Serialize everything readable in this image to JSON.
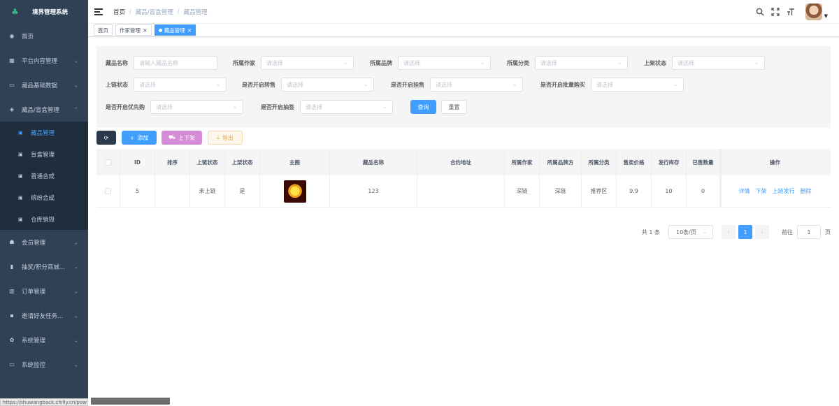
{
  "app": {
    "logo_text": "境界管理系统"
  },
  "sidebar": {
    "items": [
      {
        "label": "首页",
        "icon": "dashboard-icon"
      },
      {
        "label": "平台内容管理",
        "icon": "calendar-icon"
      },
      {
        "label": "藏品基础数据",
        "icon": "monitor-icon"
      },
      {
        "label": "藏品/盲盒管理",
        "icon": "layers-icon"
      },
      {
        "label": "会员管理",
        "icon": "peoples-icon"
      },
      {
        "label": "抽奖/积分商城...",
        "icon": "book-icon"
      },
      {
        "label": "订单管理",
        "icon": "chart-icon"
      },
      {
        "label": "邀请好友任务...",
        "icon": "list-icon"
      },
      {
        "label": "系统管理",
        "icon": "gear-icon"
      },
      {
        "label": "系统监控",
        "icon": "monitor-icon"
      }
    ],
    "submenu": [
      {
        "label": "藏品管理"
      },
      {
        "label": "盲盒管理"
      },
      {
        "label": "普通合成"
      },
      {
        "label": "缤纷合成"
      },
      {
        "label": "仓库销毁"
      }
    ]
  },
  "header": {
    "breadcrumb": [
      "首页",
      "藏品/盲盒管理",
      "藏品管理"
    ],
    "breadcrumb_sep": "/"
  },
  "tags": [
    {
      "label": "首页"
    },
    {
      "label": "作家管理"
    },
    {
      "label": "藏品管理"
    }
  ],
  "search": {
    "row1": [
      {
        "label": "藏品名称",
        "placeholder": "请输入藏品名称"
      },
      {
        "label": "所属作家",
        "placeholder": "请选择"
      },
      {
        "label": "所属品牌",
        "placeholder": "请选择"
      },
      {
        "label": "所属分类",
        "placeholder": "请选择"
      },
      {
        "label": "上架状态",
        "placeholder": "请选择"
      }
    ],
    "row2": [
      {
        "label": "上链状态",
        "placeholder": "请选择"
      },
      {
        "label": "是否开启转售",
        "placeholder": "请选择"
      },
      {
        "label": "是否开启挂售",
        "placeholder": "请选择"
      },
      {
        "label": "是否开启批量购买",
        "placeholder": "请选择"
      }
    ],
    "row3": [
      {
        "label": "是否开启优先购",
        "placeholder": "请选择"
      },
      {
        "label": "是否开启抽签",
        "placeholder": "请选择"
      }
    ],
    "query_label": "查询",
    "reset_label": "重置"
  },
  "toolbar": {
    "add_label": "添加",
    "shelf_label": "上下架",
    "export_label": "导出"
  },
  "table": {
    "columns": [
      "ID",
      "排序",
      "上链状态",
      "上架状态",
      "主图",
      "藏品名称",
      "合约地址",
      "所属作家",
      "所属品牌方",
      "所属分类",
      "售卖价格",
      "发行库存",
      "已售数量",
      "操作"
    ],
    "rows": [
      {
        "id": "5",
        "sort": "",
        "chain_status": "未上链",
        "shelf_status": "是",
        "name": "123",
        "contract": "",
        "author": "深链",
        "brand": "深链",
        "category": "推荐区",
        "price": "9.9",
        "stock": "10",
        "sold": "0",
        "actions": [
          "详情",
          "下架",
          "上链发行",
          "删除"
        ]
      }
    ]
  },
  "pagination": {
    "total": "共 1 条",
    "page_size": "10条/页",
    "current": "1",
    "goto_label": "前往",
    "goto_value": "1",
    "page_suffix": "页"
  },
  "statusbar": {
    "text": "https://shuwangback.chilly.cn/pow"
  }
}
